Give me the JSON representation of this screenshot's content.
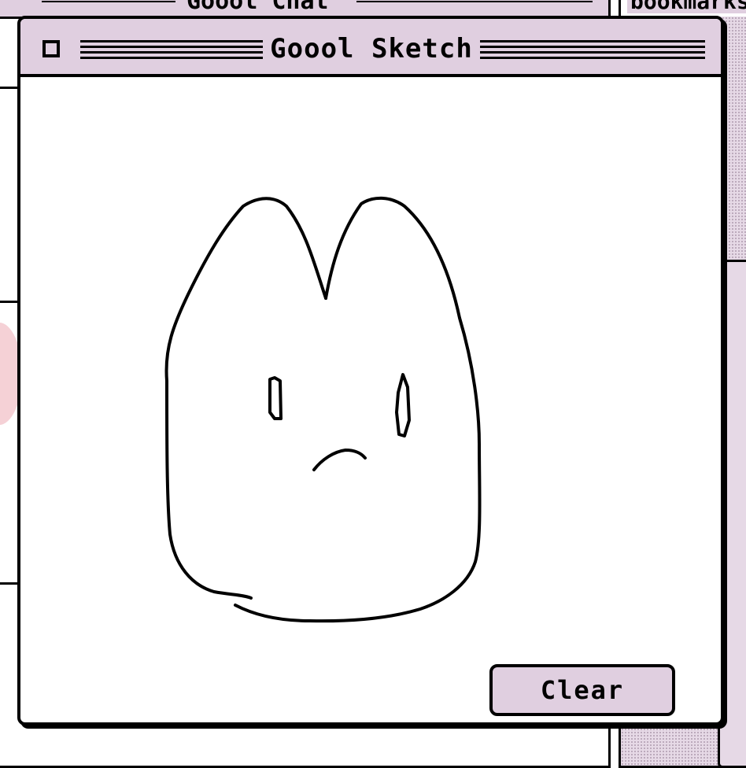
{
  "background": {
    "chat_window_title": "Goool Chat",
    "bookmarks_window_title": "bookmarks"
  },
  "sketch_window": {
    "title": "Goool Sketch",
    "clear_label": "Clear"
  },
  "colors": {
    "titlebar": "#e0cfe0",
    "border": "#000000",
    "canvas": "#ffffff",
    "button": "#e0cfe0"
  },
  "icons": {
    "close_box": "close-box-icon"
  }
}
